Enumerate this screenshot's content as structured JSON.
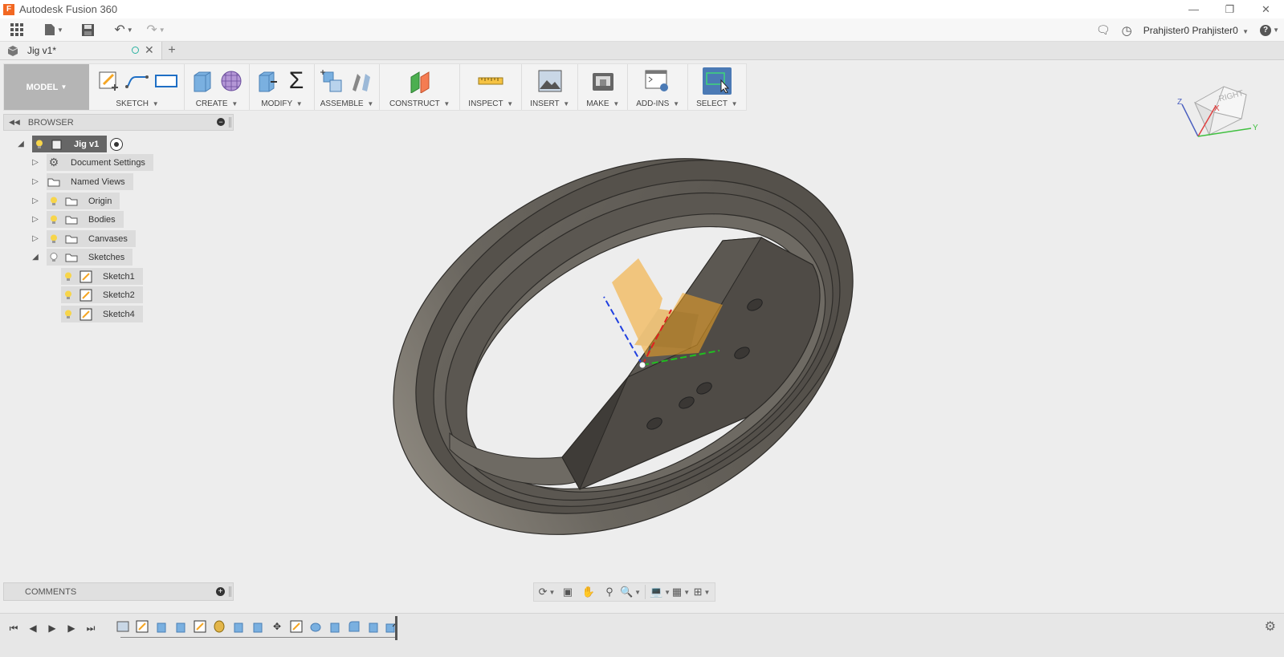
{
  "window": {
    "title": "Autodesk Fusion 360",
    "app_icon_letter": "F",
    "controls": [
      "minimize-icon",
      "restore-icon",
      "close-icon"
    ]
  },
  "quick_access": {
    "user_label": "Prahjister0 Prahjister0",
    "help_label": "?"
  },
  "document_tab": {
    "name": "Jig v1*",
    "new_tab": "+"
  },
  "toolbar": {
    "workspace": "MODEL",
    "groups": [
      {
        "label": "SKETCH",
        "icons": [
          "create-sketch-icon",
          "line-icon",
          "rectangle-icon"
        ]
      },
      {
        "label": "CREATE",
        "icons": [
          "extrude-icon",
          "form-icon"
        ]
      },
      {
        "label": "MODIFY",
        "icons": [
          "press-pull-icon",
          "sum-icon"
        ]
      },
      {
        "label": "ASSEMBLE",
        "icons": [
          "new-component-icon",
          "joint-icon"
        ]
      },
      {
        "label": "CONSTRUCT",
        "icons": [
          "offset-plane-icon"
        ]
      },
      {
        "label": "INSPECT",
        "icons": [
          "measure-icon"
        ]
      },
      {
        "label": "INSERT",
        "icons": [
          "insert-image-icon"
        ]
      },
      {
        "label": "MAKE",
        "icons": [
          "3d-print-icon"
        ]
      },
      {
        "label": "ADD-INS",
        "icons": [
          "scripts-icon"
        ]
      },
      {
        "label": "SELECT",
        "icons": [
          "select-icon"
        ]
      }
    ]
  },
  "browser": {
    "title": "BROWSER",
    "root": "Jig v1",
    "items": [
      {
        "label": "Document Settings",
        "icon": "gear-icon"
      },
      {
        "label": "Named Views",
        "icon": "folder-icon"
      },
      {
        "label": "Origin",
        "icon": "folder-icon"
      },
      {
        "label": "Bodies",
        "icon": "folder-icon"
      },
      {
        "label": "Canvases",
        "icon": "folder-icon"
      },
      {
        "label": "Sketches",
        "icon": "folder-icon"
      }
    ],
    "sketches": [
      "Sketch1",
      "Sketch2",
      "Sketch4"
    ]
  },
  "comments": {
    "title": "COMMENTS"
  },
  "viewcube": {
    "face_label": "RIGHT",
    "axis_z": "Z",
    "axis_x": "X",
    "axis_y": "Y"
  },
  "colors": {
    "accent_select": "#4b7ab5",
    "model_body": "#5e5a54",
    "origin_planes": "#f5a623",
    "axis_x": "#e02020",
    "axis_y": "#20c020",
    "axis_z": "#2040e0"
  }
}
